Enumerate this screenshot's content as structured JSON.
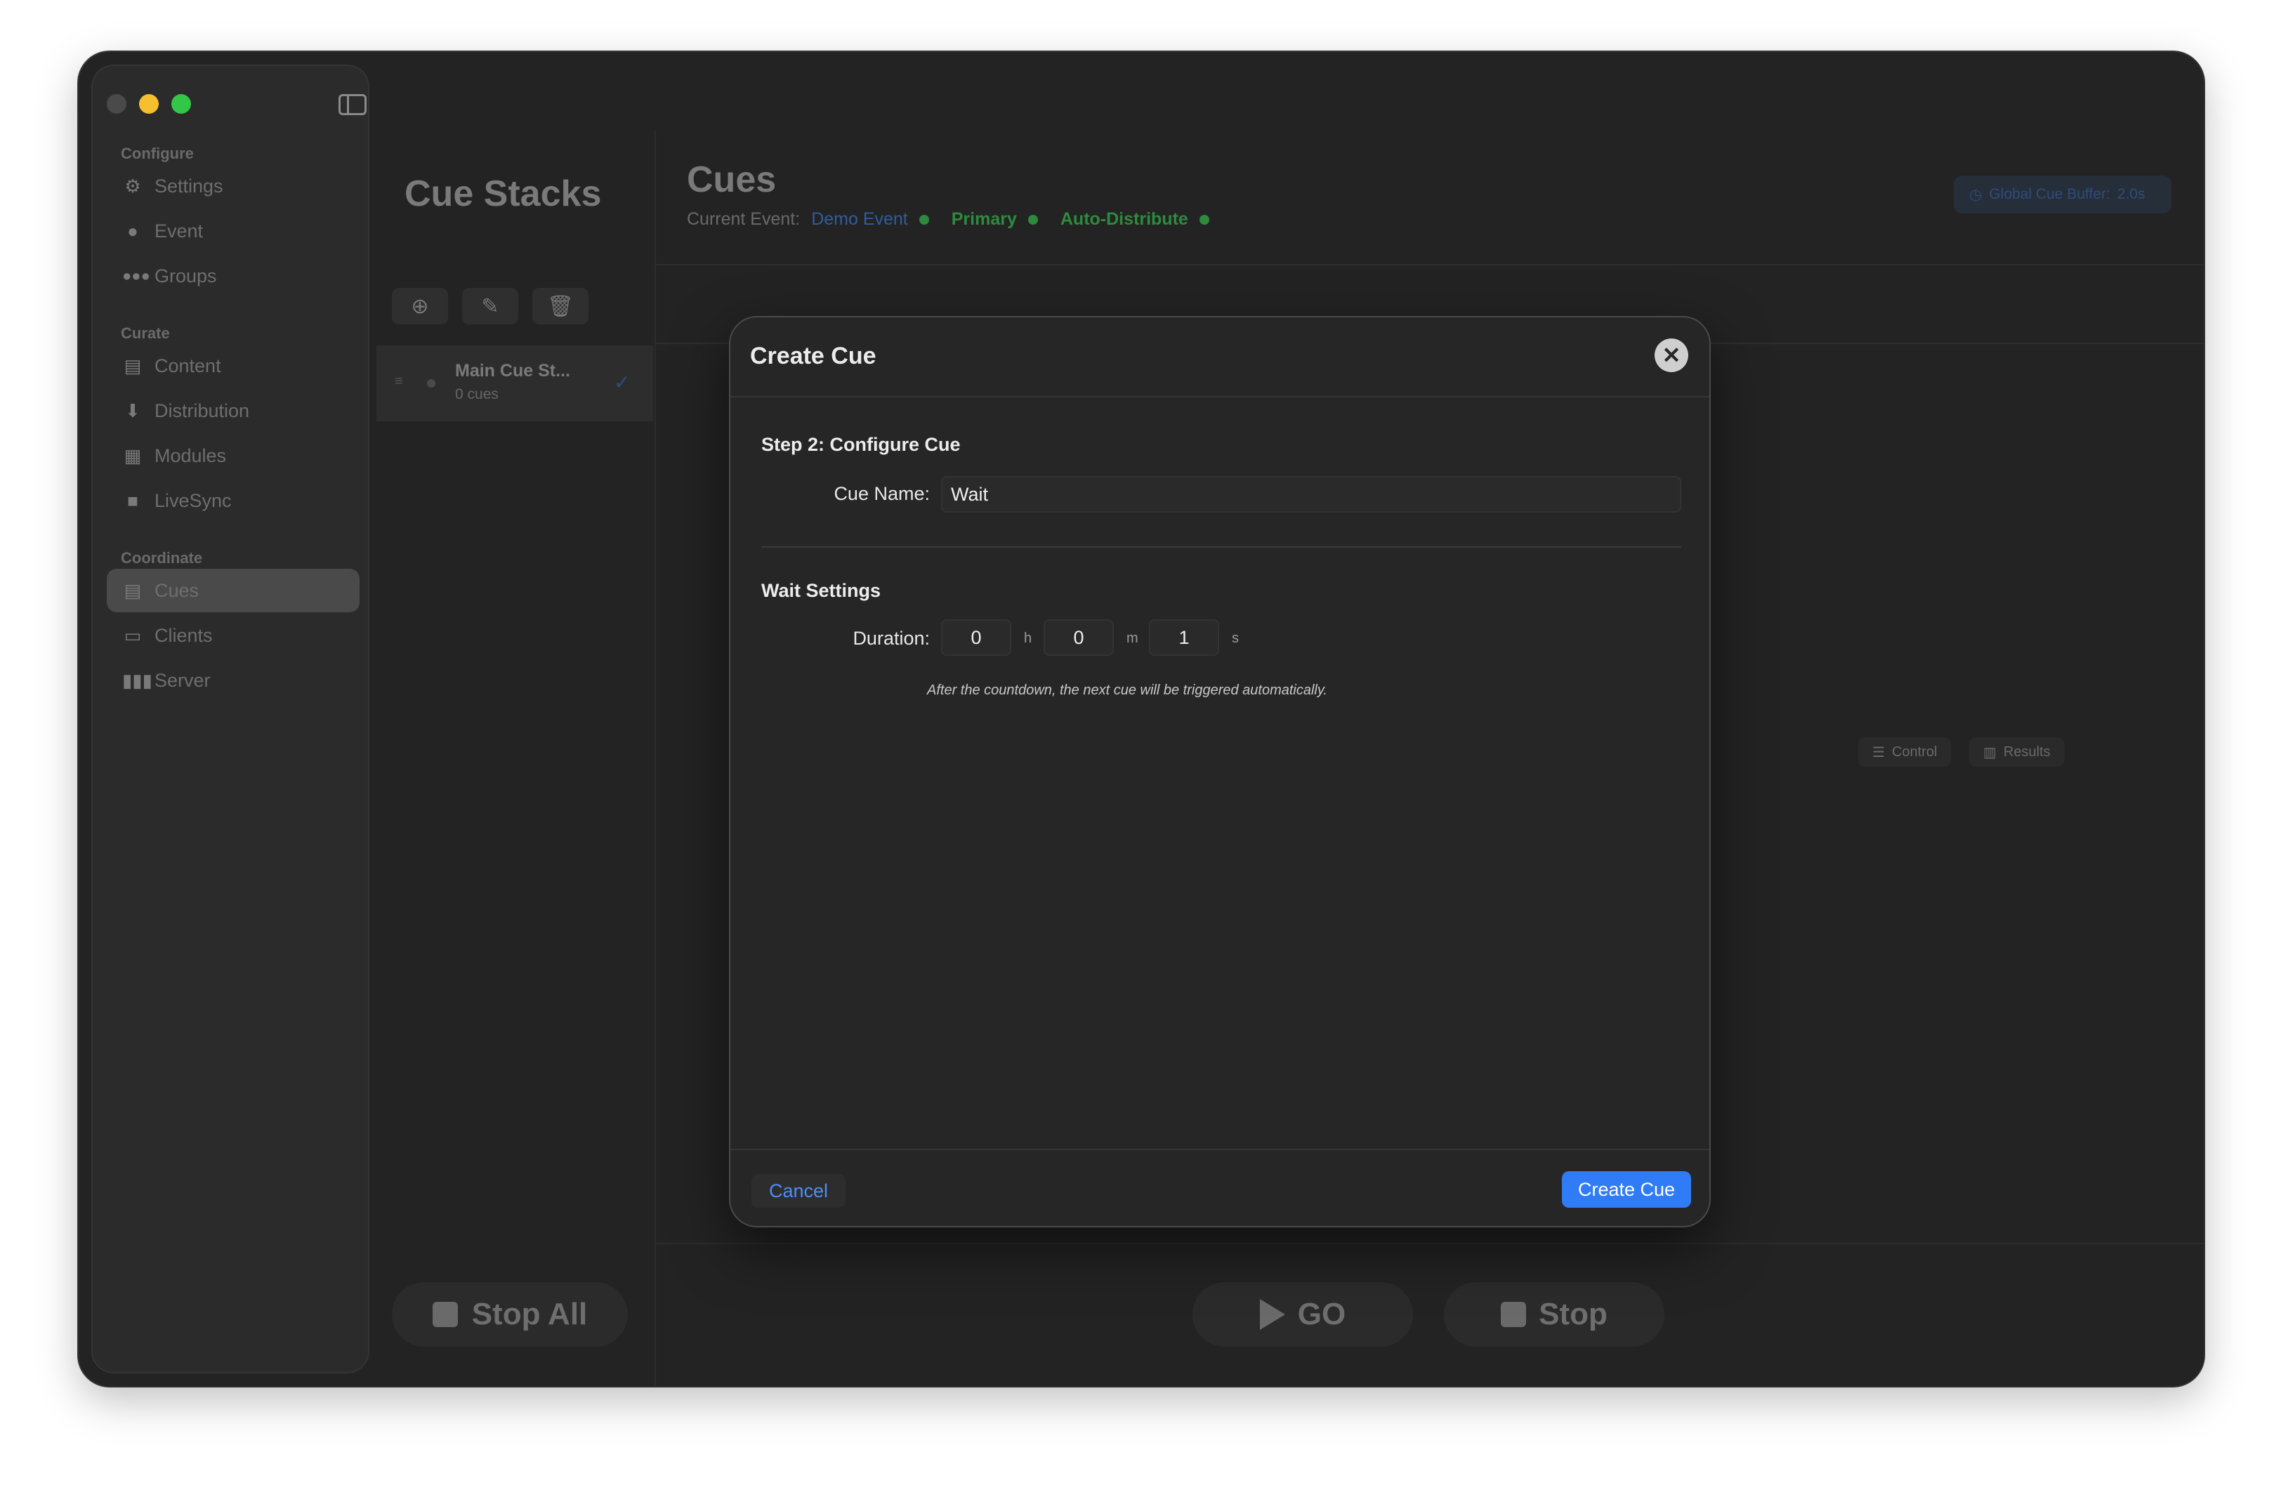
{
  "sidebar": {
    "sections": [
      {
        "label": "Configure",
        "items": [
          {
            "label": "Settings",
            "icon": "gear-icon"
          },
          {
            "label": "Event",
            "icon": "event-icon"
          },
          {
            "label": "Groups",
            "icon": "groups-icon"
          }
        ]
      },
      {
        "label": "Curate",
        "items": [
          {
            "label": "Content",
            "icon": "content-icon"
          },
          {
            "label": "Distribution",
            "icon": "distribution-icon"
          },
          {
            "label": "Modules",
            "icon": "modules-icon"
          },
          {
            "label": "LiveSync",
            "icon": "camera-icon"
          }
        ]
      },
      {
        "label": "Coordinate",
        "items": [
          {
            "label": "Cues",
            "icon": "cues-icon",
            "active": true
          },
          {
            "label": "Clients",
            "icon": "clients-icon"
          },
          {
            "label": "Server",
            "icon": "server-icon"
          }
        ]
      }
    ]
  },
  "cue_stacks": {
    "title": "Cue Stacks",
    "items": [
      {
        "name": "Main Cue St...",
        "count": "0 cues"
      }
    ],
    "stop_all_label": "Stop All"
  },
  "cues": {
    "title": "Cues",
    "current_event_label": "Current Event:",
    "event_name": "Demo Event",
    "primary_label": "Primary",
    "auto_distribute_label": "Auto-Distribute",
    "global_buffer_label": "Global Cue Buffer:",
    "global_buffer_value": "2.0s",
    "control_label": "Control",
    "results_label": "Results",
    "go_label": "GO",
    "stop_label": "Stop"
  },
  "modal": {
    "title": "Create Cue",
    "step_title": "Step 2: Configure Cue",
    "cue_name_label": "Cue Name:",
    "cue_name_value": "Wait",
    "wait_settings_title": "Wait Settings",
    "duration_label": "Duration:",
    "hours": "0",
    "hours_unit": "h",
    "minutes": "0",
    "minutes_unit": "m",
    "seconds": "1",
    "seconds_unit": "s",
    "hint": "After the countdown, the next cue will be triggered automatically.",
    "cancel_label": "Cancel",
    "create_label": "Create Cue"
  },
  "colors": {
    "accent": "#2f7cf6",
    "status_green": "#2e8a3e",
    "traffic_close": "#4a4a4a",
    "traffic_minimize": "#f5bf2e",
    "traffic_zoom": "#33c748"
  }
}
